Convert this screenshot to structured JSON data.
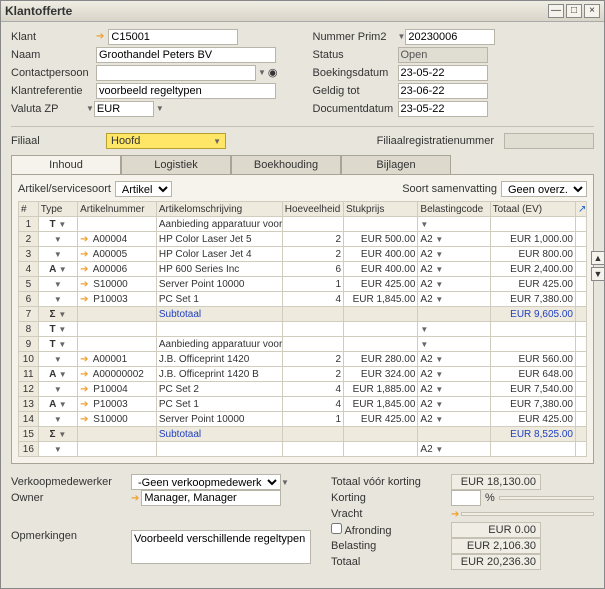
{
  "window": {
    "title": "Klantofferte"
  },
  "header": {
    "left": {
      "klant_lbl": "Klant",
      "klant_val": "C15001",
      "naam_lbl": "Naam",
      "naam_val": "Groothandel Peters BV",
      "contact_lbl": "Contactpersoon",
      "contact_val": "",
      "ref_lbl": "Klantreferentie",
      "ref_val": "voorbeeld regeltypen",
      "valuta_lbl": "Valuta ZP",
      "valuta_val": "EUR"
    },
    "right": {
      "nummer_lbl": "Nummer",
      "nummer_sel": "Prim2",
      "nummer_val": "20230006",
      "status_lbl": "Status",
      "status_val": "Open",
      "boek_lbl": "Boekingsdatum",
      "boek_val": "23-05-22",
      "geldig_lbl": "Geldig tot",
      "geldig_val": "23-06-22",
      "doc_lbl": "Documentdatum",
      "doc_val": "23-05-22"
    }
  },
  "filiaal": {
    "lbl": "Filiaal",
    "val": "Hoofd",
    "reg_lbl": "Filiaalregistratienummer",
    "reg_val": ""
  },
  "tabs": {
    "inhoud": "Inhoud",
    "logistiek": "Logistiek",
    "boekhouding": "Boekhouding",
    "bijlagen": "Bijlagen"
  },
  "grid": {
    "as_lbl": "Artikel/servicesoort",
    "as_val": "Artikel",
    "ss_lbl": "Soort samenvatting",
    "ss_val": "Geen overz.",
    "cols": {
      "num": "#",
      "type": "Type",
      "artnum": "Artikelnummer",
      "artoms": "Artikelomschrijving",
      "hoev": "Hoeveelheid",
      "stuk": "Stukprijs",
      "bel": "Belastingcode",
      "tot": "Totaal (EV)"
    },
    "rows": [
      {
        "n": "1",
        "type": "T",
        "artnum": "",
        "oms": "Aanbieding apparatuur voor locatie A",
        "hoev": "",
        "stuk": "",
        "bel": "",
        "tot": ""
      },
      {
        "n": "2",
        "type": "",
        "artnum": "A00004",
        "oms": "HP Color Laser Jet 5",
        "hoev": "2",
        "stuk": "EUR 500.00",
        "bel": "A2",
        "tot": "EUR 1,000.00"
      },
      {
        "n": "3",
        "type": "",
        "artnum": "A00005",
        "oms": "HP Color Laser Jet 4",
        "hoev": "2",
        "stuk": "EUR 400.00",
        "bel": "A2",
        "tot": "EUR 800.00"
      },
      {
        "n": "4",
        "type": "A",
        "artnum": "A00006",
        "oms": "HP 600 Series Inc",
        "hoev": "6",
        "stuk": "EUR 400.00",
        "bel": "A2",
        "tot": "EUR 2,400.00"
      },
      {
        "n": "5",
        "type": "",
        "artnum": "S10000",
        "oms": "Server Point 10000",
        "hoev": "1",
        "stuk": "EUR 425.00",
        "bel": "A2",
        "tot": "EUR 425.00"
      },
      {
        "n": "6",
        "type": "",
        "artnum": "P10003",
        "oms": "PC Set 1",
        "hoev": "4",
        "stuk": "EUR 1,845.00",
        "bel": "A2",
        "tot": "EUR 7,380.00"
      },
      {
        "n": "7",
        "type": "Σ",
        "sub": true,
        "lbl": "Subtotaal",
        "tot": "EUR 9,605.00"
      },
      {
        "n": "8",
        "type": "T",
        "artnum": "",
        "oms": "",
        "hoev": "",
        "stuk": "",
        "bel": "",
        "tot": ""
      },
      {
        "n": "9",
        "type": "T",
        "artnum": "",
        "oms": "Aanbieding apparatuur voor locatie B",
        "hoev": "",
        "stuk": "",
        "bel": "",
        "tot": ""
      },
      {
        "n": "10",
        "type": "",
        "artnum": "A00001",
        "oms": "J.B. Officeprint 1420",
        "hoev": "2",
        "stuk": "EUR 280.00",
        "bel": "A2",
        "tot": "EUR 560.00"
      },
      {
        "n": "11",
        "type": "A",
        "artnum": "A00000002",
        "oms": "J.B. Officeprint 1420 B",
        "hoev": "2",
        "stuk": "EUR 324.00",
        "bel": "A2",
        "tot": "EUR 648.00"
      },
      {
        "n": "12",
        "type": "",
        "artnum": "P10004",
        "oms": "PC Set 2",
        "hoev": "4",
        "stuk": "EUR 1,885.00",
        "bel": "A2",
        "tot": "EUR 7,540.00"
      },
      {
        "n": "13",
        "type": "A",
        "artnum": "P10003",
        "oms": "PC Set 1",
        "hoev": "4",
        "stuk": "EUR 1,845.00",
        "bel": "A2",
        "tot": "EUR 7,380.00"
      },
      {
        "n": "14",
        "type": "",
        "artnum": "S10000",
        "oms": "Server Point 10000",
        "hoev": "1",
        "stuk": "EUR 425.00",
        "bel": "A2",
        "tot": "EUR 425.00"
      },
      {
        "n": "15",
        "type": "Σ",
        "sub": true,
        "lbl": "Subtotaal",
        "tot": "EUR 8,525.00"
      },
      {
        "n": "16",
        "type": "",
        "artnum": "",
        "oms": "",
        "hoev": "",
        "stuk": "",
        "bel": "A2",
        "tot": ""
      }
    ]
  },
  "footer": {
    "verkoop_lbl": "Verkoopmedewerker",
    "verkoop_val": "-Geen verkoopmedewerker-",
    "owner_lbl": "Owner",
    "owner_val": "Manager, Manager",
    "opm_lbl": "Opmerkingen",
    "opm_val": "Voorbeeld verschillende regeltypen",
    "tvk_lbl": "Totaal vóór korting",
    "tvk_val": "EUR 18,130.00",
    "kort_lbl": "Korting",
    "kort_pct": "",
    "pct": "%",
    "vracht_lbl": "Vracht",
    "vracht_val": "",
    "afr_lbl": "Afronding",
    "afr_val": "EUR 0.00",
    "bel_lbl": "Belasting",
    "bel_val": "EUR 2,106.30",
    "tot_lbl": "Totaal",
    "tot_val": "EUR 20,236.30"
  }
}
